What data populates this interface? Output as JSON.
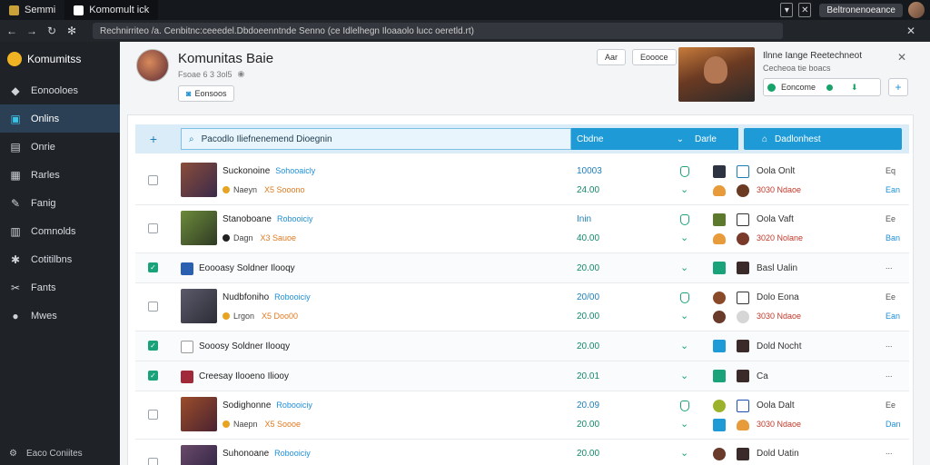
{
  "browser": {
    "tabs": [
      {
        "label": "Semmi",
        "active": false
      },
      {
        "label": "Komomult ick",
        "active": true
      }
    ],
    "pill": "Beltronenoeance",
    "url": "Rechnirriteo /a. Cenbitnc:ceeedel.Dbdoeenntnde Senno (ce Idlelhegn Iloaaolo lucc oeretld.rt)"
  },
  "sidebar": {
    "brand": "Komumitss",
    "items": [
      {
        "label": "Eonooloes",
        "icon": "gem-icon",
        "active": false
      },
      {
        "label": "Onlins",
        "icon": "monitor-icon",
        "active": true
      },
      {
        "label": "Onrie",
        "icon": "list-icon",
        "active": false
      },
      {
        "label": "Rarles",
        "icon": "box-icon",
        "active": false
      },
      {
        "label": "Fanig",
        "icon": "edit-icon",
        "active": false
      },
      {
        "label": "Comnolds",
        "icon": "grid-icon",
        "active": false
      },
      {
        "label": "Cotitilbns",
        "icon": "puzzle-icon",
        "active": false
      },
      {
        "label": "Fants",
        "icon": "tool-icon",
        "active": false
      },
      {
        "label": "Mwes",
        "icon": "circle-icon",
        "active": false
      }
    ],
    "footer": "Eaco Coniites"
  },
  "profile": {
    "name": "Komunitas  Baie",
    "sub": "Fsoae 6 3 3ol5",
    "button": "Eonsoos",
    "btn_a": "Aar",
    "btn_b": "Eoooce"
  },
  "promo": {
    "title": "Ilnne Iange Reetechneot",
    "subtitle": "Cecheoa tie boacs",
    "field": "Eoncome",
    "plus": "+"
  },
  "toolbar": {
    "plus": "+",
    "search_placeholder": "Pacodlo Iliefnenemend Dioegnin",
    "seg1": "Cbdne",
    "seg2": "Darle",
    "cta": "Dadlonhest"
  },
  "rows": [
    {
      "type": "tall",
      "checked": false,
      "thumb": "t1",
      "title": "Suckonoine",
      "tag": "Sohooaicly",
      "meta": "Naeyn",
      "sale": "X5 Sooono",
      "num1": "10003",
      "num2": "24.00",
      "lbl1": "Oola Onlt",
      "lbl2": "3030 Ndaoe",
      "act1": "Eq",
      "act2": "Ean"
    },
    {
      "type": "tall",
      "checked": false,
      "thumb": "t2",
      "title": "Stanoboane",
      "tag": "Robooiciy",
      "meta": "Dagn",
      "sale": "X3 Sauoe",
      "num1": "Inin",
      "num2": "40.00",
      "lbl1": "Oola Vaft",
      "lbl2": "3020 Nolane",
      "act1": "Ee",
      "act2": "Ban"
    },
    {
      "type": "short",
      "checked": true,
      "title": "Eoooasy Soldner Ilooqy",
      "num1": "20.00",
      "lbl1": "Basl Ualin",
      "act1": "..."
    },
    {
      "type": "tall",
      "checked": false,
      "thumb": "t3",
      "title": "Nudbfoniho",
      "tag": "Robooiciy",
      "meta": "Lrgon",
      "sale": "X5 Doo00",
      "num1": "20/00",
      "num2": "20.00",
      "lbl1": "Dolo Eona",
      "lbl2": "3030 Ndaoe",
      "act1": "Ee",
      "act2": "Ean"
    },
    {
      "type": "short",
      "checked": true,
      "title": "Sooosy Soldner Ilooqy",
      "num1": "20.00",
      "lbl1": "Dold Nocht",
      "act1": "..."
    },
    {
      "type": "short",
      "checked": true,
      "title": "Creesay Ilooeno Iliooy",
      "num1": "20.01",
      "lbl1": "Ca",
      "act1": "..."
    },
    {
      "type": "tall",
      "checked": false,
      "thumb": "t4",
      "title": "Sodighonne",
      "tag": "Robooiciy",
      "meta": "Naepn",
      "sale": "X5 Soooe",
      "num1": "20.09",
      "num2": "20.00",
      "lbl1": "Oola Dalt",
      "lbl2": "3030 Ndaoe",
      "act1": "Ee",
      "act2": "Dan"
    },
    {
      "type": "tall",
      "checked": false,
      "thumb": "t5",
      "title": "Suhonoane",
      "tag": "Robooiciy",
      "meta": "",
      "sale": "",
      "num1": "20.00",
      "num2": "",
      "lbl1": "Dold Uatin",
      "lbl2": "",
      "act1": "...",
      "act2": ""
    }
  ]
}
